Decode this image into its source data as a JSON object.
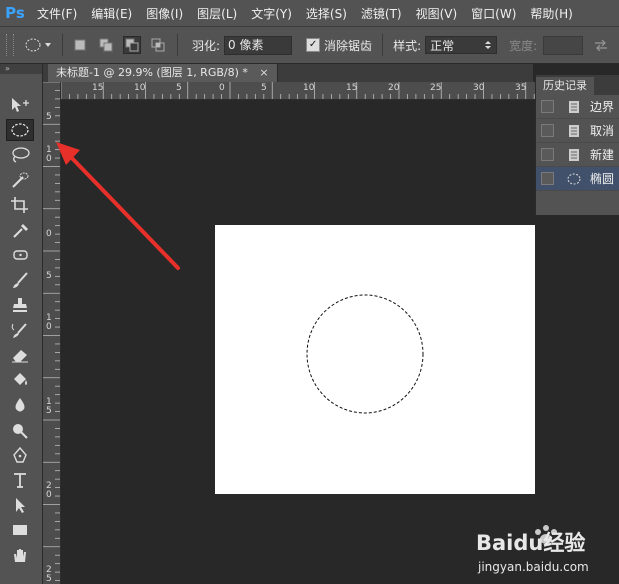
{
  "app": {
    "logo": "Ps"
  },
  "menu": [
    "文件(F)",
    "编辑(E)",
    "图像(I)",
    "图层(L)",
    "文字(Y)",
    "选择(S)",
    "滤镜(T)",
    "视图(V)",
    "窗口(W)",
    "帮助(H)"
  ],
  "window_controls": {
    "minimize": "─",
    "restore": "□",
    "close": "✕"
  },
  "options": {
    "feather_label": "羽化:",
    "feather_value": "0 像素",
    "antialias_label": "消除锯齿",
    "antialias_checked": "✓",
    "style_label": "样式:",
    "style_value": "正常",
    "width_label": "宽度:"
  },
  "document": {
    "tab_title": "未标题-1 @ 29.9% (图层 1, RGB/8) *",
    "close_glyph": "×",
    "canvas_color": "#ffffff"
  },
  "toolbox": {
    "collapse_glyph": "»"
  },
  "ruler": {
    "h_labels": [
      "15",
      "10",
      "5",
      "0",
      "5",
      "10",
      "15",
      "20",
      "25",
      "30",
      "35"
    ],
    "v_labels": [
      "5",
      "1\n0",
      "0",
      "5",
      "1\n0",
      "1\n5",
      "2\n0",
      "2\n5"
    ]
  },
  "history": {
    "title": "历史记录",
    "items": [
      {
        "label": "边界",
        "icon": "document-icon"
      },
      {
        "label": "取消",
        "icon": "document-icon"
      },
      {
        "label": "新建",
        "icon": "document-icon"
      },
      {
        "label": "椭圆",
        "icon": "ellipse-select-icon"
      }
    ],
    "selected_index": 3
  },
  "watermark": {
    "brand": "Baidu经验",
    "url": "jingyan.baidu.com"
  },
  "colors": {
    "accent": "#3aa3ff",
    "arrow": "#e8302a",
    "selected_row": "#41516b"
  }
}
